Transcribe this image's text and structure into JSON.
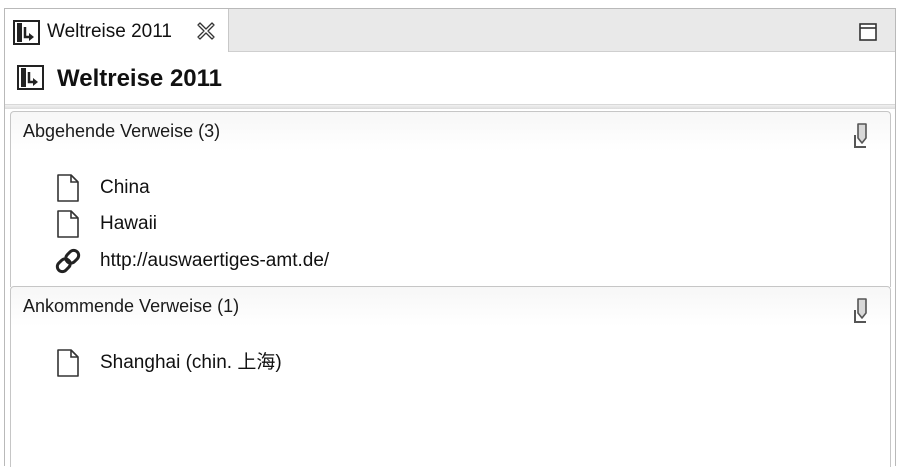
{
  "tab": {
    "title": "Weltreise 2011",
    "icon": "document-move-icon",
    "close_icon": "close-icon"
  },
  "window": {
    "maximize_icon": "maximize-icon"
  },
  "header": {
    "title": "Weltreise 2011",
    "icon": "document-move-icon"
  },
  "sections": [
    {
      "title": "Abgehende Verweise (3)",
      "action_icon": "link-action-icon",
      "items": [
        {
          "label": "China",
          "icon": "document-icon"
        },
        {
          "label": "Hawaii",
          "icon": "document-icon"
        },
        {
          "label": "http://auswaertiges-amt.de/",
          "icon": "link-icon"
        }
      ]
    },
    {
      "title": "Ankommende Verweise (1)",
      "action_icon": "link-action-icon",
      "items": [
        {
          "label": "Shanghai (chin. 上海)",
          "icon": "document-icon"
        }
      ]
    }
  ]
}
